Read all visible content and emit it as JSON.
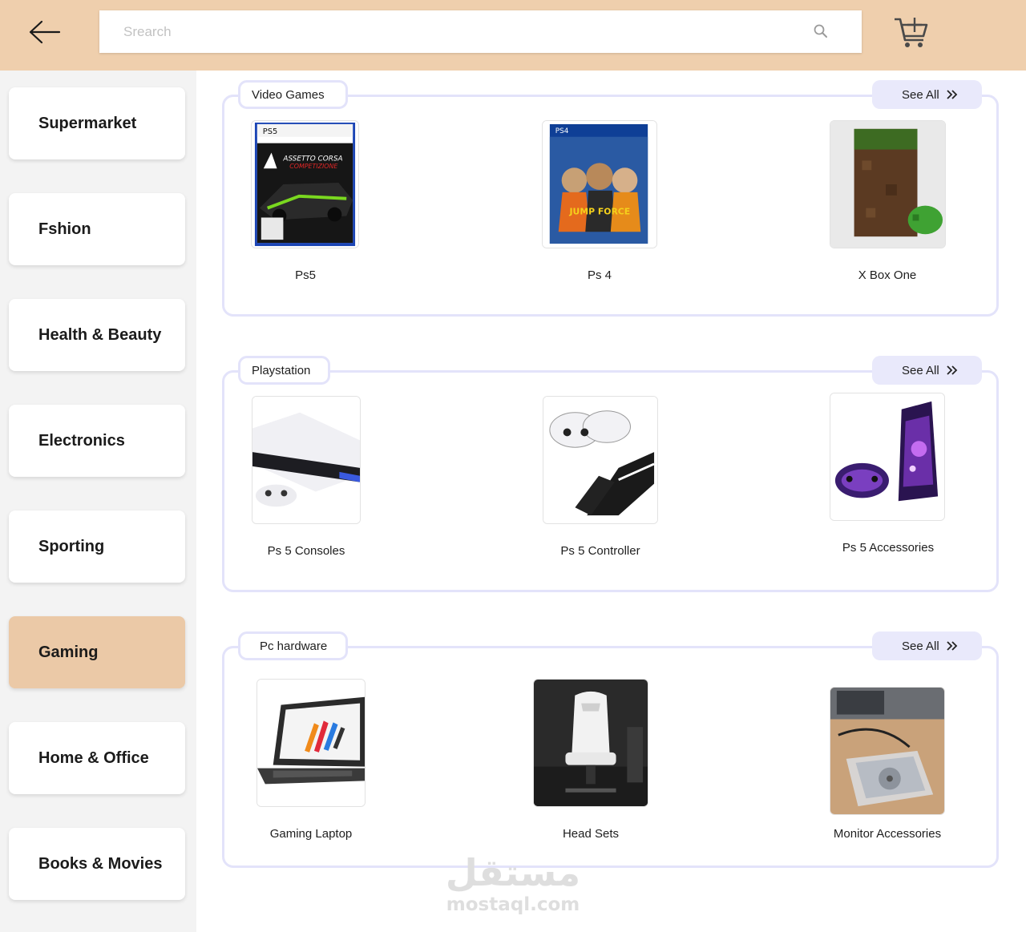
{
  "header": {
    "search_placeholder": "Srearch"
  },
  "sidebar": {
    "items": [
      {
        "label": "Supermarket",
        "active": false
      },
      {
        "label": "Fshion",
        "active": false
      },
      {
        "label": "Health & Beauty",
        "active": false
      },
      {
        "label": "Electronics",
        "active": false
      },
      {
        "label": "Sporting",
        "active": false
      },
      {
        "label": "Gaming",
        "active": true
      },
      {
        "label": "Home & Office",
        "active": false
      },
      {
        "label": "Books & Movies",
        "active": false
      }
    ]
  },
  "sections": [
    {
      "title": "Video Games",
      "see_all": "See All",
      "products": [
        {
          "name": "Ps5",
          "image": "ps5-game-cover"
        },
        {
          "name": "Ps 4",
          "image": "ps4-game-cover"
        },
        {
          "name": "X Box One",
          "image": "xbox-console"
        }
      ]
    },
    {
      "title": "Playstation",
      "see_all": "See All",
      "products": [
        {
          "name": "Ps 5 Consoles",
          "image": "ps5-console"
        },
        {
          "name": "Ps 5 Controller",
          "image": "ps5-controller-dock"
        },
        {
          "name": "Ps 5 Accessories",
          "image": "ps5-skin-accessories"
        }
      ]
    },
    {
      "title": "Pc hardware",
      "see_all": "See All",
      "products": [
        {
          "name": "Gaming Laptop",
          "image": "gaming-laptop"
        },
        {
          "name": "Head Sets",
          "image": "gaming-chair"
        },
        {
          "name": "Monitor Accessories",
          "image": "hdd-enclosure"
        }
      ]
    }
  ],
  "watermark": {
    "arabic": "مستقل",
    "latin": "mostaql.com"
  },
  "colors": {
    "header_bg": "#efcfad",
    "sidebar_bg": "#f3f3f3",
    "active_category": "#ebc9a7",
    "section_border": "#e3e3fa",
    "see_all_bg": "#e9e9fb"
  }
}
